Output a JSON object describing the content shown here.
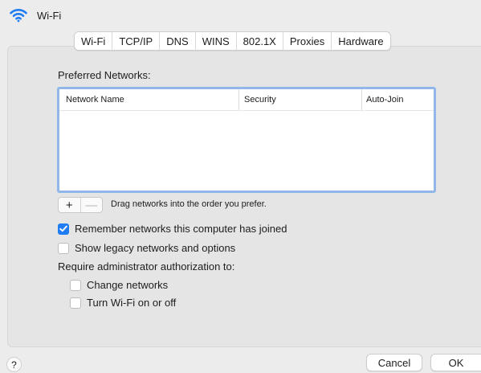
{
  "header": {
    "title": "Wi-Fi",
    "icon": "wifi-icon"
  },
  "tabs": [
    {
      "label": "Wi-Fi",
      "active": true
    },
    {
      "label": "TCP/IP"
    },
    {
      "label": "DNS"
    },
    {
      "label": "WINS"
    },
    {
      "label": "802.1X"
    },
    {
      "label": "Proxies"
    },
    {
      "label": "Hardware"
    }
  ],
  "preferred": {
    "title": "Preferred Networks:",
    "columns": [
      "Network Name",
      "Security",
      "Auto-Join"
    ],
    "rows": []
  },
  "table_controls": {
    "add": "+",
    "remove": "—",
    "hint": "Drag networks into the order you prefer."
  },
  "options": {
    "remember": {
      "label": "Remember networks this computer has joined",
      "checked": true
    },
    "legacy": {
      "label": "Show legacy networks and options",
      "checked": false
    }
  },
  "admin": {
    "title": "Require administrator authorization to:",
    "change_networks": {
      "label": "Change networks",
      "checked": false
    },
    "turn_wifi": {
      "label": "Turn Wi-Fi on or off",
      "checked": false
    }
  },
  "footer": {
    "help": "?",
    "cancel": "Cancel",
    "ok": "OK"
  },
  "colors": {
    "accent": "#1f7cf2",
    "focus_ring": "#8fb7ea",
    "background": "#ececec"
  }
}
